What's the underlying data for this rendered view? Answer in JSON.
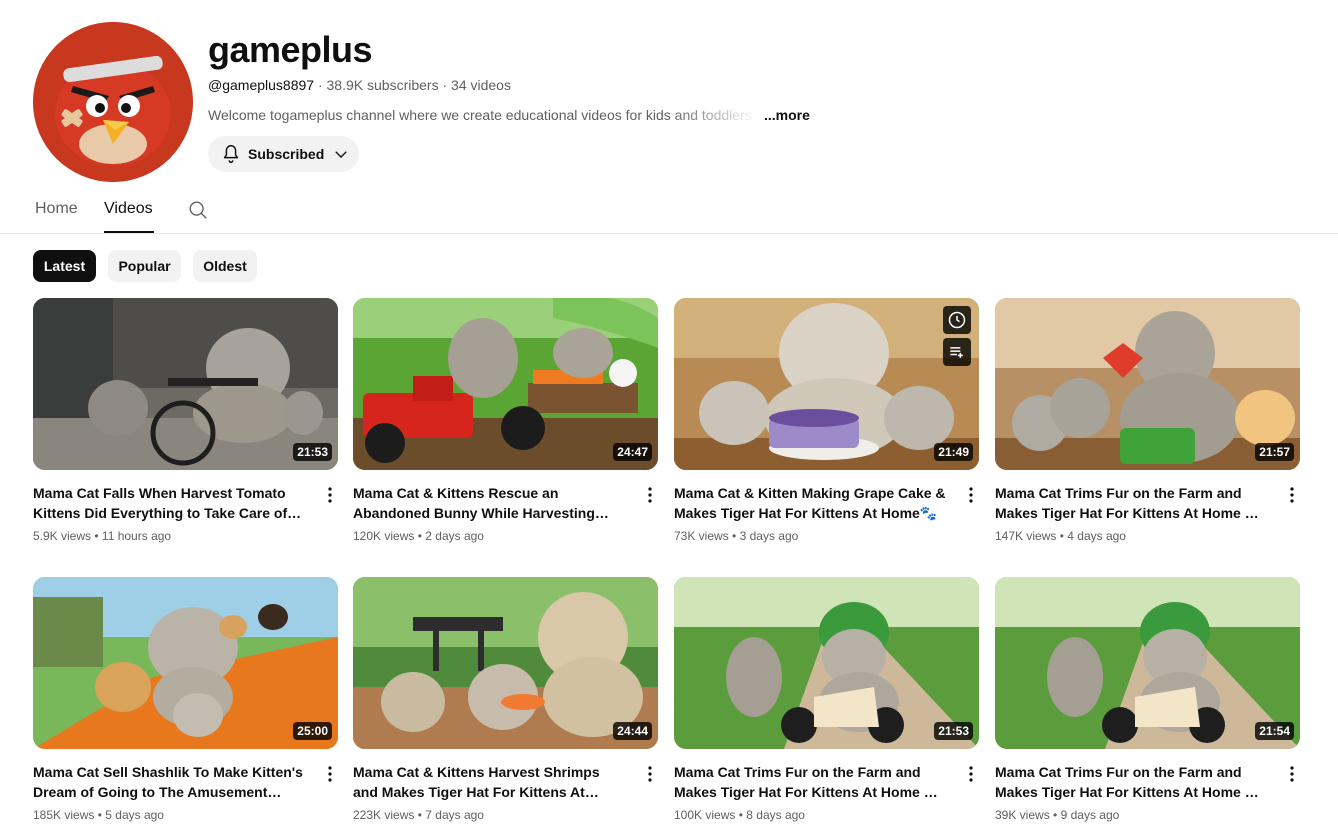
{
  "channel": {
    "name": "gameplus",
    "handle": "@gameplus8897",
    "subscribers": "38.9K subscribers",
    "video_count": "34 videos",
    "separator": "·",
    "description": "Welcome togameplus channel where we create educational videos for kids and toddlers",
    "more_label": "...more",
    "subscribe_label": "Subscribed",
    "avatar_icon": "angry-red-bird-avatar"
  },
  "tabs": [
    {
      "label": "Home",
      "active": false
    },
    {
      "label": "Videos",
      "active": true
    }
  ],
  "chips": [
    {
      "label": "Latest",
      "active": true
    },
    {
      "label": "Popular",
      "active": false
    },
    {
      "label": "Oldest",
      "active": false
    }
  ],
  "videos": [
    {
      "title": "Mama Cat Falls When Harvest Tomato Kittens Did Everything to Take Care of…",
      "views": "5.9K views",
      "age": "11 hours ago",
      "duration": "21:53"
    },
    {
      "title": "Mama Cat & Kittens Rescue an Abandoned Bunny While Harvesting Carrots, Bunny…",
      "views": "120K views",
      "age": "2 days ago",
      "duration": "24:47"
    },
    {
      "title": "Mama Cat & Kitten Making Grape Cake & Makes Tiger Hat For Kittens At Home🐾",
      "views": "73K views",
      "age": "3 days ago",
      "duration": "21:49"
    },
    {
      "title": "Mama Cat Trims Fur on the Farm and Makes Tiger Hat For Kittens At Home 🐾🍭🎩",
      "views": "147K views",
      "age": "4 days ago",
      "duration": "21:57"
    },
    {
      "title": "Mama Cat Sell Shashlik To Make Kitten's Dream of Going to The Amusement Park…",
      "views": "185K views",
      "age": "5 days ago",
      "duration": "25:00"
    },
    {
      "title": "Mama Cat & Kittens Harvest Shrimps and Makes Tiger Hat For Kittens At Home🐾…",
      "views": "223K views",
      "age": "7 days ago",
      "duration": "24:44"
    },
    {
      "title": "Mama Cat Trims Fur on the Farm and Makes Tiger Hat For Kittens At Home 🐾🍭🎩",
      "views": "100K views",
      "age": "8 days ago",
      "duration": "21:53"
    },
    {
      "title": "Mama Cat Trims Fur on the Farm and Makes Tiger Hat For Kittens At Home 🐾🍭🎩",
      "views": "39K views",
      "age": "9 days ago",
      "duration": "21:54"
    }
  ],
  "stats_separator": "•",
  "hover_icons": [
    "watch-later-icon",
    "add-to-queue-icon"
  ],
  "colors": {
    "text_primary": "#0f0f0f",
    "text_secondary": "#606060",
    "chip_bg": "#f2f2f2",
    "chip_active_bg": "#0f0f0f",
    "avatar_red": "#c23521"
  }
}
